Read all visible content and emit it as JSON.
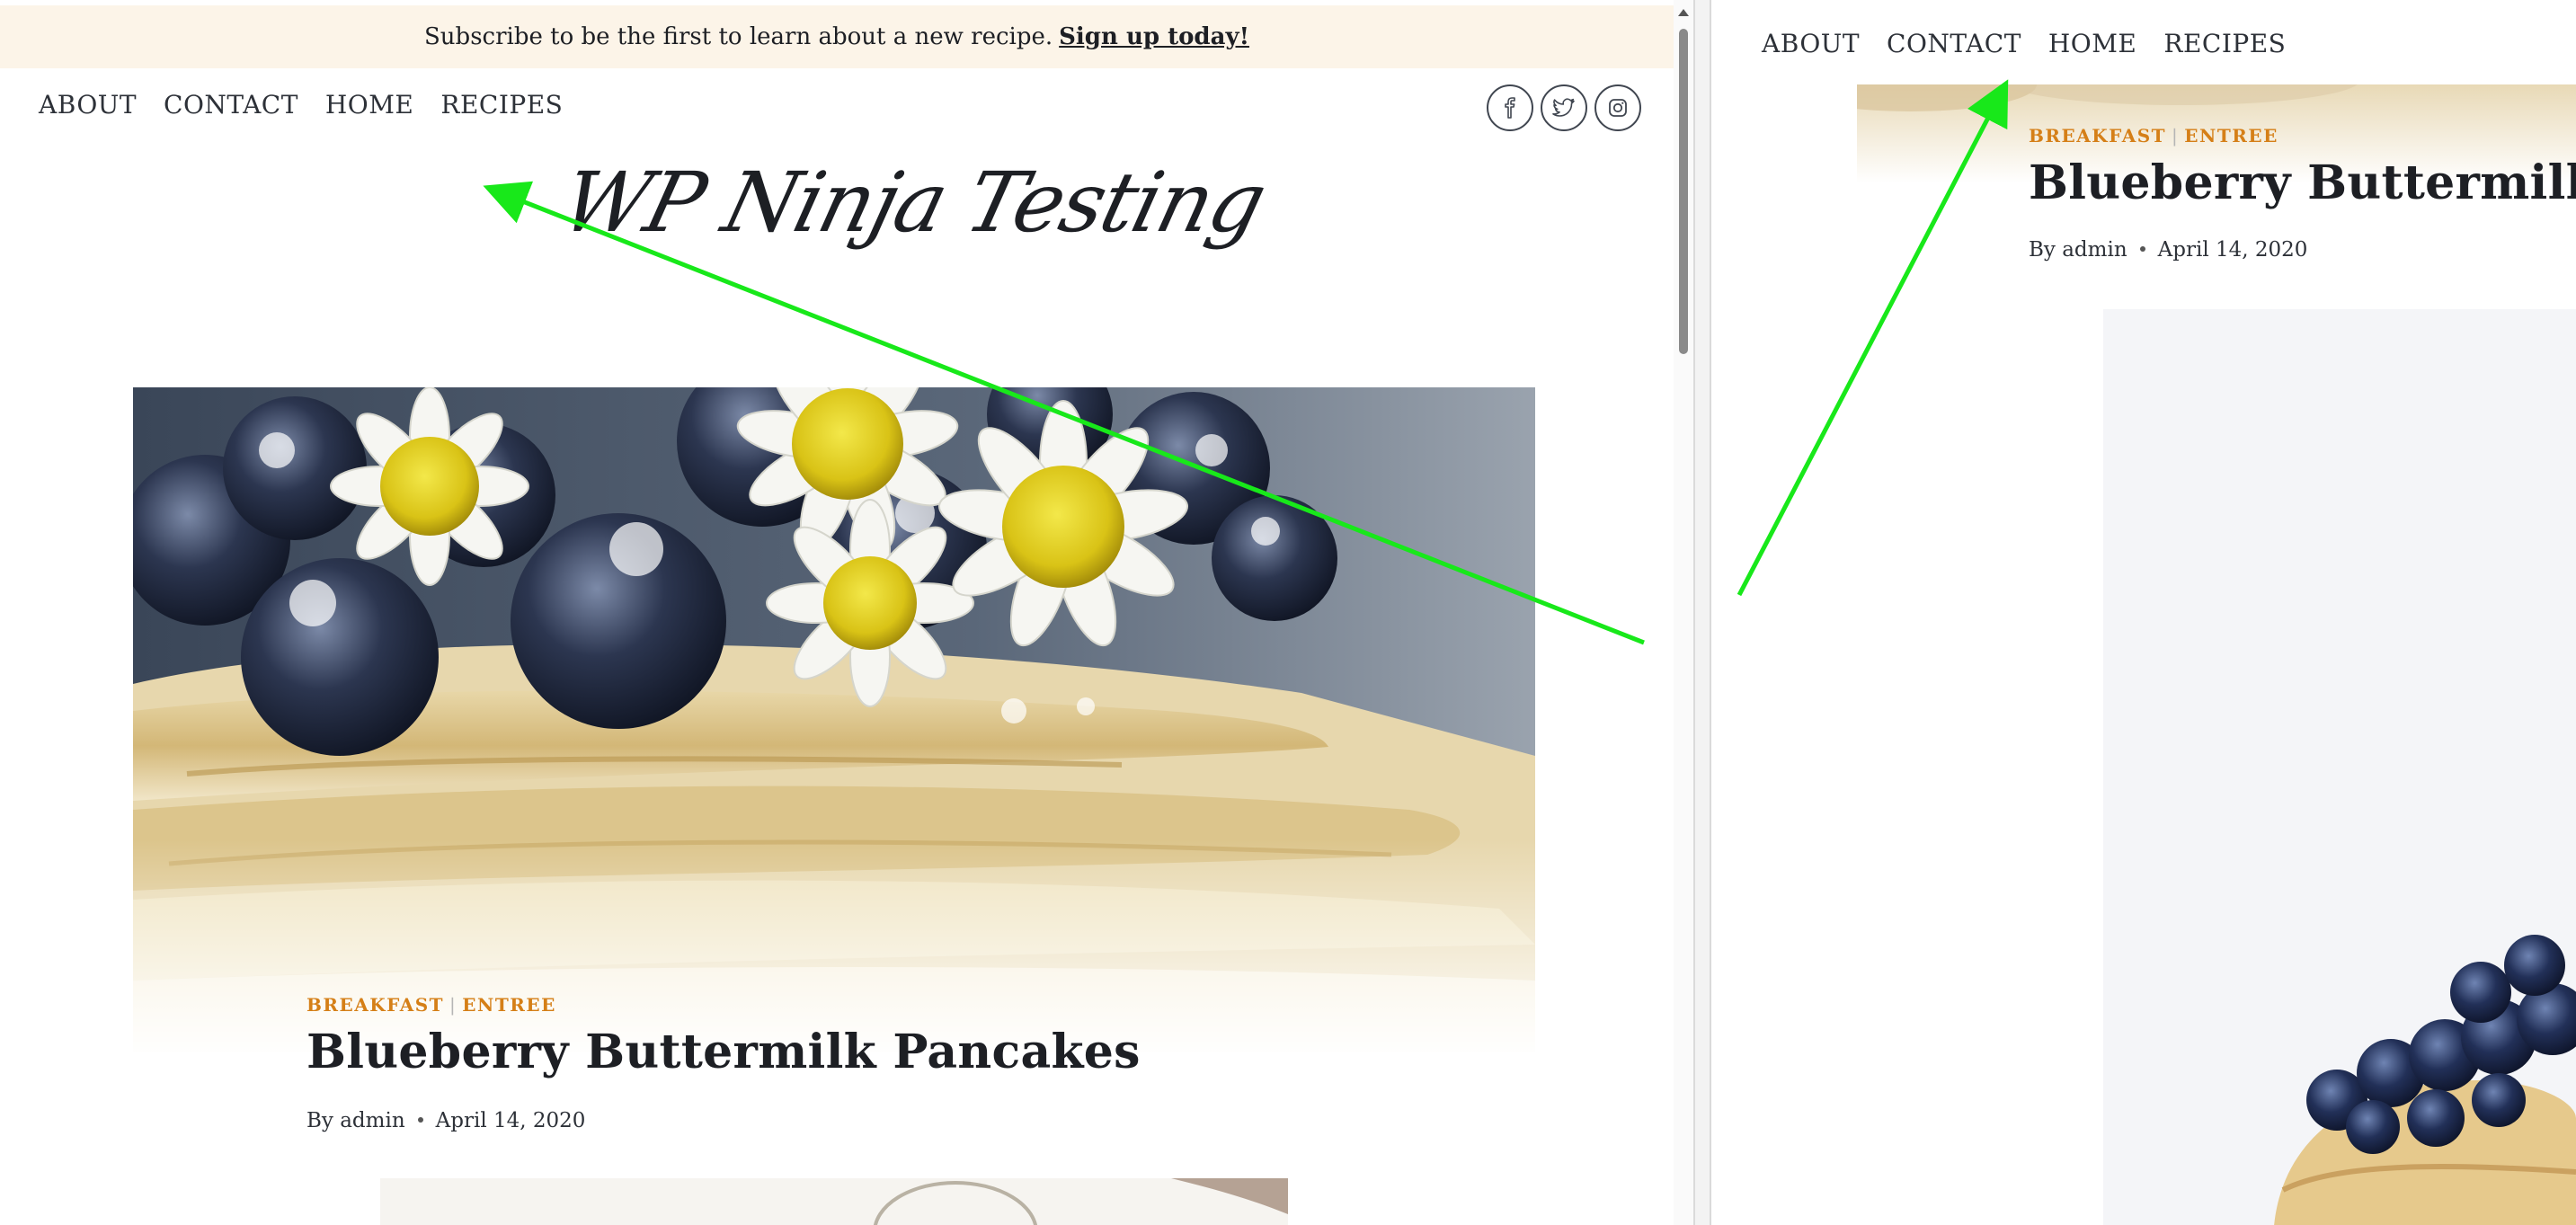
{
  "banner": {
    "text": "Subscribe to be the first to learn about a new recipe.",
    "link": "Sign up today!"
  },
  "nav": {
    "items": [
      {
        "label": "ABOUT"
      },
      {
        "label": "CONTACT"
      },
      {
        "label": "HOME"
      },
      {
        "label": "RECIPES"
      }
    ]
  },
  "social": {
    "icons": [
      "facebook-icon",
      "twitter-icon",
      "instagram-icon"
    ]
  },
  "site": {
    "title": "WP Ninja Testing"
  },
  "post": {
    "categories": [
      "BREAKFAST",
      "ENTREE"
    ],
    "category_separator": "|",
    "title": "Blueberry Buttermilk Pancakes",
    "by": "By",
    "author": "admin",
    "date": "April 14, 2020"
  },
  "right_pane": {
    "nav": [
      "ABOUT",
      "CONTACT",
      "HOME",
      "RECIPES"
    ],
    "title_visible": "Blueberry Buttermilk Panc"
  },
  "colors": {
    "banner_bg": "#fcf4e8",
    "category": "#d57f17",
    "heading": "#1d1f24",
    "annotation_arrow": "#18e81a"
  }
}
